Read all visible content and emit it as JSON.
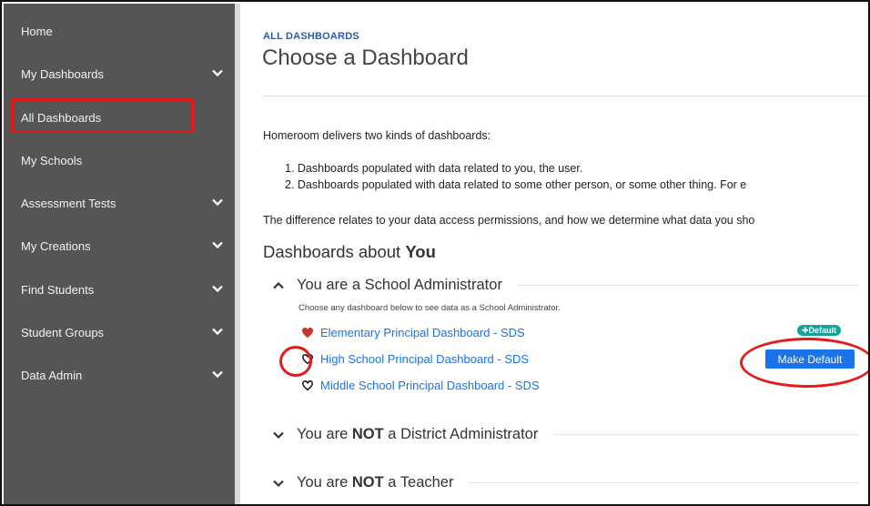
{
  "sidebar": {
    "items": [
      {
        "label": "Home",
        "has_chevron": false
      },
      {
        "label": "My Dashboards",
        "has_chevron": true
      },
      {
        "label": "All Dashboards",
        "has_chevron": false,
        "highlighted": true
      },
      {
        "label": "My Schools",
        "has_chevron": false
      },
      {
        "label": "Assessment Tests",
        "has_chevron": true
      },
      {
        "label": "My Creations",
        "has_chevron": true
      },
      {
        "label": "Find Students",
        "has_chevron": true
      },
      {
        "label": "Student Groups",
        "has_chevron": true
      },
      {
        "label": "Data Admin",
        "has_chevron": true
      }
    ]
  },
  "main": {
    "breadcrumb": "ALL DASHBOARDS",
    "title": "Choose a Dashboard",
    "intro": "Homeroom delivers two kinds of dashboards:",
    "kinds": [
      "1. Dashboards populated with data related to you, the user.",
      "2. Dashboards populated with data related to some other person, or some other thing. For e"
    ],
    "difference": "The difference relates to your data access permissions, and how we determine what data you sho",
    "section_heading_prefix": "Dashboards about ",
    "section_heading_bold": "You",
    "groups": [
      {
        "prefix": "You are a School Administrator",
        "bold": "",
        "suffix": "",
        "expanded": true
      },
      {
        "prefix": "You are ",
        "bold": "NOT",
        "suffix": " a District Administrator",
        "expanded": false
      },
      {
        "prefix": "You are ",
        "bold": "NOT",
        "suffix": " a Teacher",
        "expanded": false
      }
    ],
    "helper_text": "Choose any dashboard below to see data as a School Administrator.",
    "dashboards": [
      {
        "label": "Elementary Principal Dashboard - SDS",
        "favorite": true
      },
      {
        "label": "High School Principal Dashboard - SDS",
        "favorite": false
      },
      {
        "label": "Middle School Principal Dashboard - SDS",
        "favorite": false
      }
    ],
    "default_badge": "✚Default",
    "make_default_label": "Make Default"
  },
  "colors": {
    "sidebar_bg": "#555555",
    "link": "#1a73e8",
    "accent_blue": "#2c5aa0",
    "badge_teal": "#17a398",
    "annotation_red": "#e31b1b",
    "heart_red": "#c0392b"
  },
  "icons": {
    "chevron": "chevron-down-icon",
    "caret_up": "caret-up-icon",
    "caret_down": "caret-down-icon",
    "heart_filled": "heart-filled-icon",
    "heart_outline": "heart-outline-icon"
  }
}
